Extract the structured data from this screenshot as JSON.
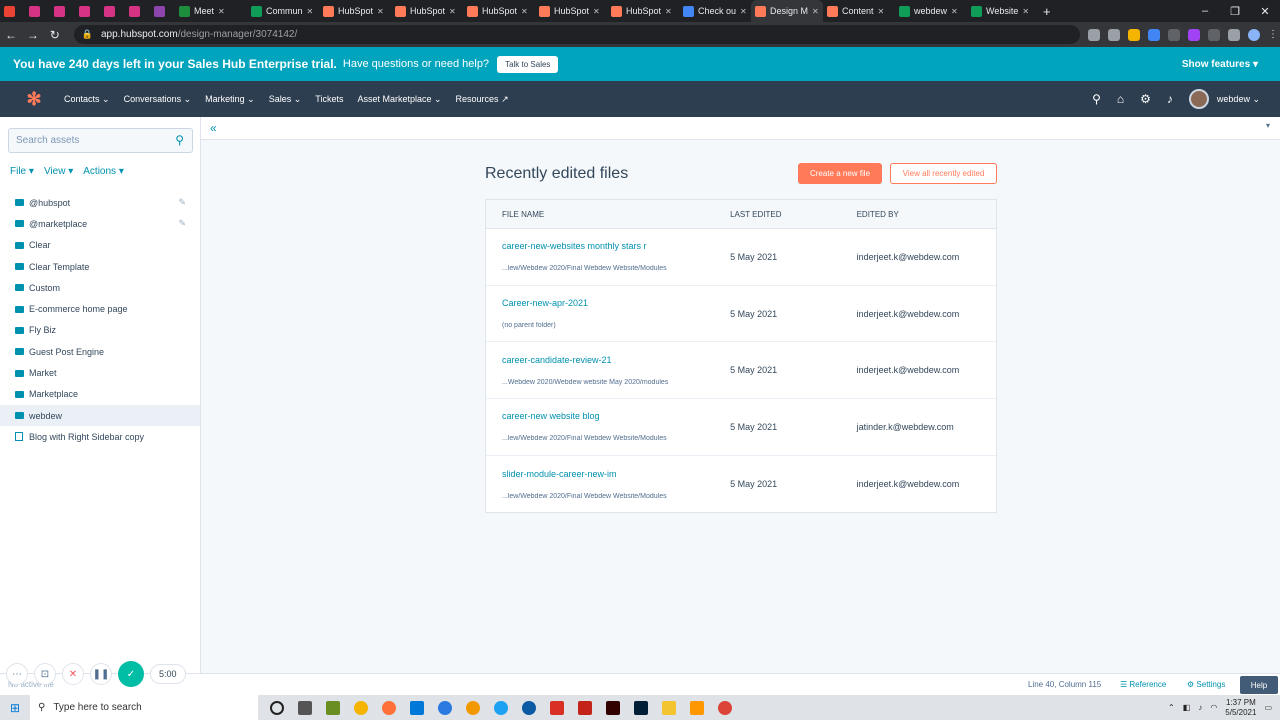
{
  "browser": {
    "tabs": [
      {
        "title": "",
        "color": "#ea4335"
      },
      {
        "title": "",
        "color": "#d63384"
      },
      {
        "title": "",
        "color": "#d63384"
      },
      {
        "title": "",
        "color": "#d63384"
      },
      {
        "title": "",
        "color": "#d63384"
      },
      {
        "title": "",
        "color": "#d63384"
      },
      {
        "title": "",
        "color": "#8e44ad"
      },
      {
        "title": "Meet",
        "color": "#1e8e3e"
      },
      {
        "title": "Commun",
        "color": "#0f9d58"
      },
      {
        "title": "HubSpot",
        "color": "#ff7a59"
      },
      {
        "title": "HubSpot",
        "color": "#ff7a59"
      },
      {
        "title": "HubSpot",
        "color": "#ff7a59"
      },
      {
        "title": "HubSpot",
        "color": "#ff7a59"
      },
      {
        "title": "HubSpot",
        "color": "#ff7a59"
      },
      {
        "title": "Check ou",
        "color": "#4285f4"
      },
      {
        "title": "Design M",
        "color": "#ff7a59",
        "active": true
      },
      {
        "title": "Content",
        "color": "#ff7a59"
      },
      {
        "title": "webdew",
        "color": "#0f9d58"
      },
      {
        "title": "Website",
        "color": "#0f9d58"
      }
    ],
    "url_host": "app.hubspot.com",
    "url_path": "/design-manager/3074142/"
  },
  "trial": {
    "message": "You have 240 days left in your Sales Hub Enterprise trial.",
    "question": "Have questions or need help?",
    "talk_button": "Talk to Sales",
    "show_features": "Show features"
  },
  "nav": {
    "items": [
      "Contacts",
      "Conversations",
      "Marketing",
      "Sales",
      "Tickets",
      "Asset Marketplace",
      "Resources"
    ],
    "user": "webdew"
  },
  "sidebar": {
    "search_placeholder": "Search assets",
    "menu": {
      "file": "File",
      "view": "View",
      "actions": "Actions"
    },
    "items": [
      {
        "label": "@hubspot",
        "type": "folder",
        "pinned": true
      },
      {
        "label": "@marketplace",
        "type": "folder",
        "pinned": true
      },
      {
        "label": "Clear",
        "type": "folder"
      },
      {
        "label": "Clear Template",
        "type": "folder"
      },
      {
        "label": "Custom",
        "type": "folder"
      },
      {
        "label": "E-commerce home page",
        "type": "folder"
      },
      {
        "label": "Fly Biz",
        "type": "folder"
      },
      {
        "label": "Guest Post Engine",
        "type": "folder"
      },
      {
        "label": "Market",
        "type": "folder"
      },
      {
        "label": "Marketplace",
        "type": "folder"
      },
      {
        "label": "webdew",
        "type": "folder",
        "selected": true
      },
      {
        "label": "Blog with Right Sidebar copy",
        "type": "file"
      }
    ]
  },
  "main": {
    "heading": "Recently edited files",
    "create_button": "Create a new file",
    "view_all_button": "View all recently edited",
    "columns": [
      "FILE NAME",
      "LAST EDITED",
      "EDITED BY"
    ],
    "rows": [
      {
        "name": "career-new-websites monthly stars r",
        "path": "...lew/Webdew 2020/Final Webdew Website/Modules",
        "edited": "5 May 2021",
        "by": "inderjeet.k@webdew.com"
      },
      {
        "name": "Career-new-apr-2021",
        "path": "(no parent folder)",
        "edited": "5 May 2021",
        "by": "inderjeet.k@webdew.com"
      },
      {
        "name": "career-candidate-review-21",
        "path": "...Webdew 2020/Webdew website May 2020/modules",
        "edited": "5 May 2021",
        "by": "inderjeet.k@webdew.com"
      },
      {
        "name": "career-new website blog",
        "path": "...lew/Webdew 2020/Final Webdew Website/Modules",
        "edited": "5 May 2021",
        "by": "jatinder.k@webdew.com"
      },
      {
        "name": "slider-module-career-new-im",
        "path": "...lew/Webdew 2020/Final Webdew Website/Modules",
        "edited": "5 May 2021",
        "by": "inderjeet.k@webdew.com"
      }
    ]
  },
  "statusbar": {
    "left": "No active file",
    "position": "Line 40, Column 115",
    "reference": "Reference",
    "settings": "Settings",
    "help": "Help"
  },
  "recorder": {
    "time": "5:00"
  },
  "taskbar": {
    "search_placeholder": "Type here to search",
    "time": "1:37 PM",
    "date": "5/5/2021"
  }
}
